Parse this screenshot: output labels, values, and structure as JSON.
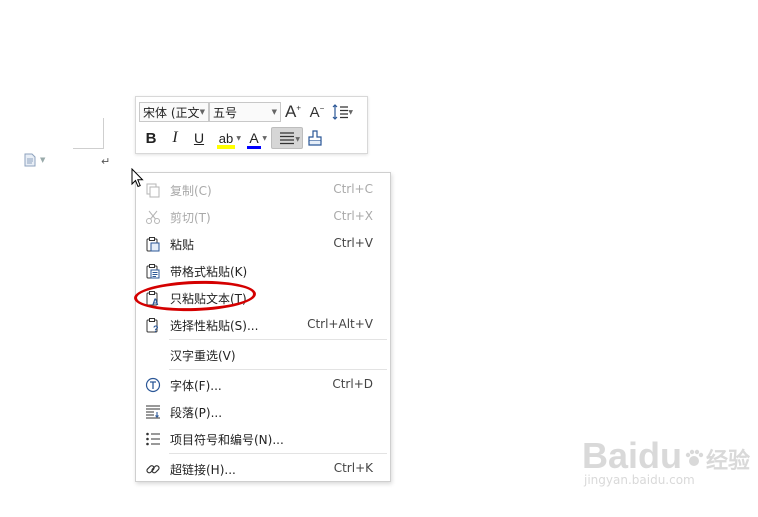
{
  "document": {
    "paragraph_mark": "↵"
  },
  "mini_toolbar": {
    "font_name": "宋体 (正文",
    "font_size": "五号",
    "bold": "B",
    "italic": "I",
    "underline": "U",
    "highlight": "ab",
    "font_color": "A",
    "grow_font": "A",
    "shrink_font": "A",
    "highlight_color": "#ffff00",
    "font_color_value": "#0000ff"
  },
  "context_menu": {
    "items": [
      {
        "label": "复制(C)",
        "shortcut": "Ctrl+C",
        "icon": "copy-icon",
        "enabled": false
      },
      {
        "label": "剪切(T)",
        "shortcut": "Ctrl+X",
        "icon": "scissors-icon",
        "enabled": false
      },
      {
        "label": "粘贴",
        "shortcut": "Ctrl+V",
        "icon": "paste-icon",
        "enabled": true
      },
      {
        "label": "带格式粘贴(K)",
        "shortcut": "",
        "icon": "paste-format-icon",
        "enabled": true
      },
      {
        "label": "只粘贴文本(T)",
        "shortcut": "",
        "icon": "paste-text-icon",
        "enabled": true,
        "highlighted": true
      },
      {
        "label": "选择性粘贴(S)...",
        "shortcut": "Ctrl+Alt+V",
        "icon": "paste-special-icon",
        "enabled": true
      },
      {
        "label": "汉字重选(V)",
        "shortcut": "",
        "icon": "",
        "enabled": true
      },
      {
        "label": "字体(F)...",
        "shortcut": "Ctrl+D",
        "icon": "font-icon",
        "enabled": true
      },
      {
        "label": "段落(P)...",
        "shortcut": "",
        "icon": "paragraph-icon",
        "enabled": true
      },
      {
        "label": "项目符号和编号(N)...",
        "shortcut": "",
        "icon": "bullet-list-icon",
        "enabled": true
      },
      {
        "label": "超链接(H)...",
        "shortcut": "Ctrl+K",
        "icon": "link-icon",
        "enabled": true
      }
    ],
    "annotation_color": "#d40000"
  },
  "watermark": {
    "logo": "Baidu",
    "brand": "经验",
    "url": "jingyan.baidu.com"
  }
}
